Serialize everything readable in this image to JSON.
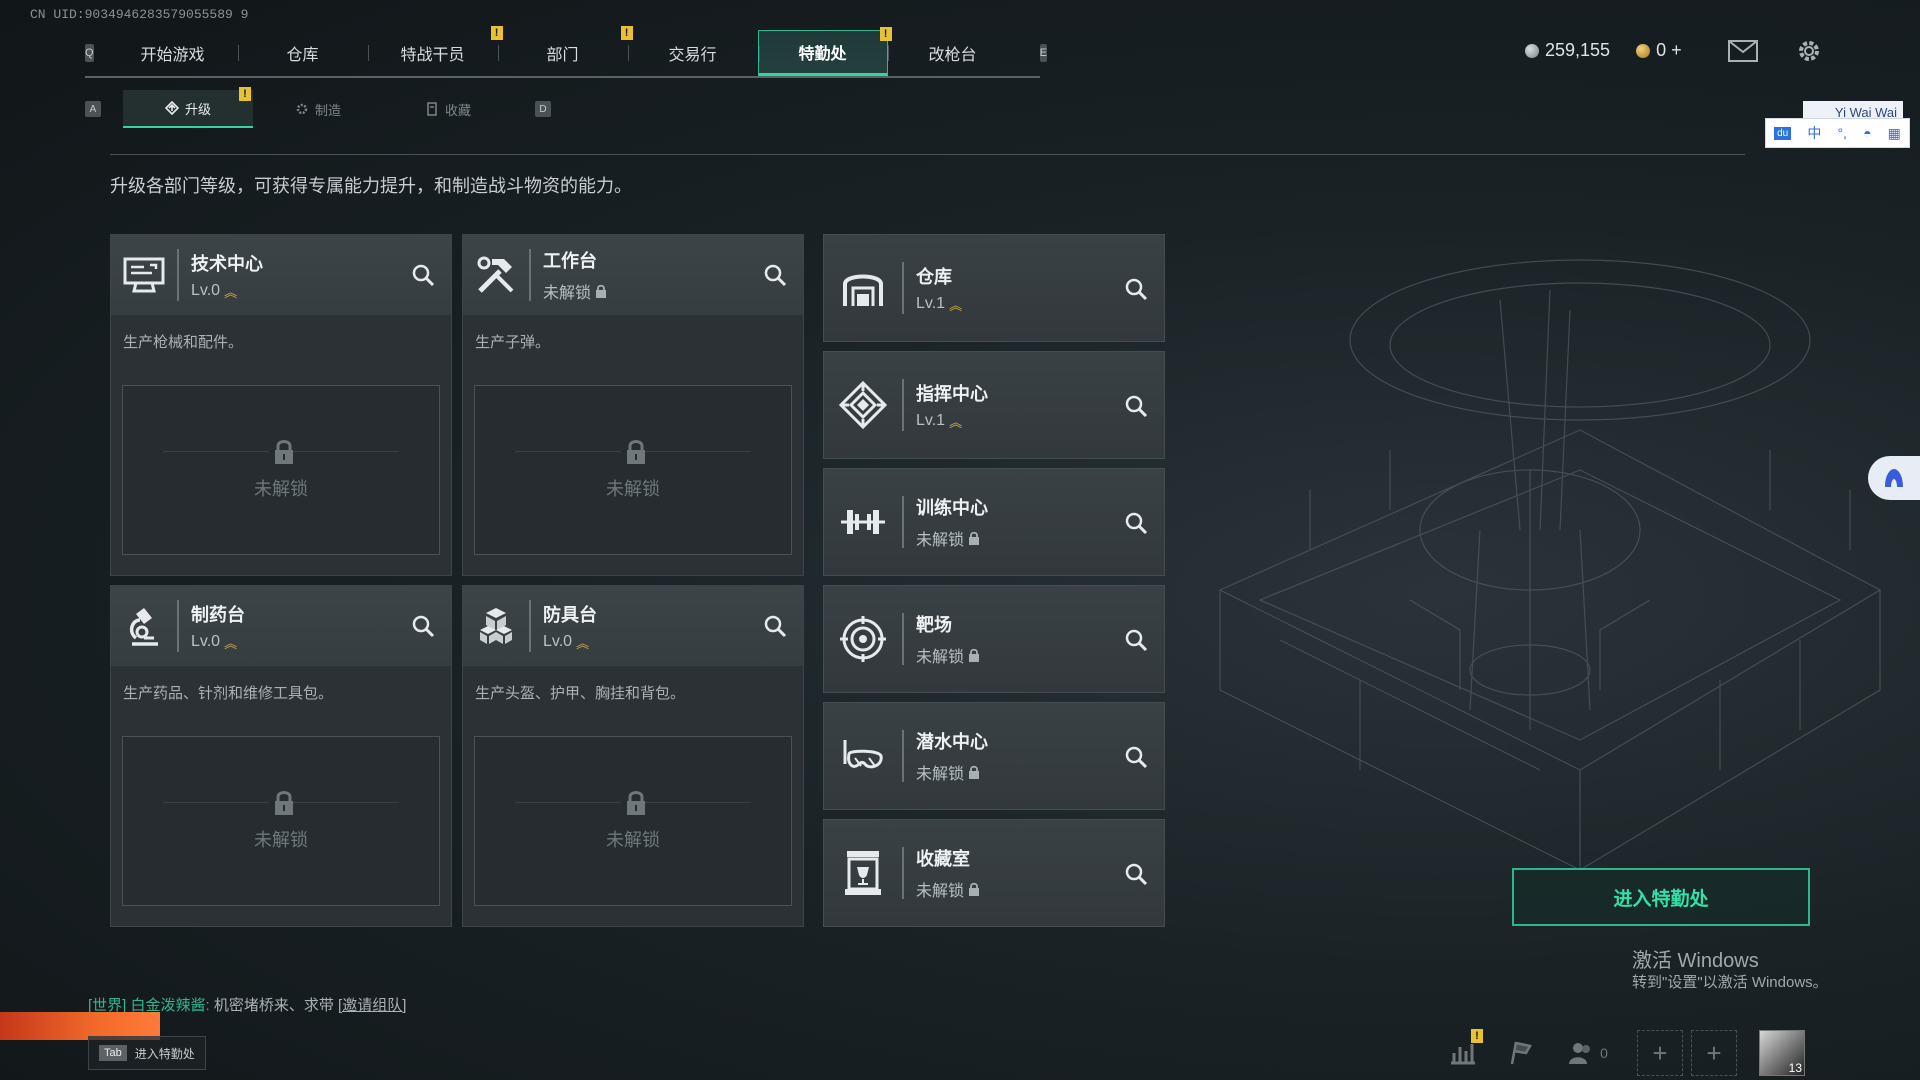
{
  "uid": "CN UID:9034946283579055589 9",
  "top_nav": {
    "left_key": "Q",
    "right_key": "E",
    "tabs": [
      {
        "label": "开始游戏",
        "badge": ""
      },
      {
        "label": "仓库",
        "badge": ""
      },
      {
        "label": "特战干员",
        "badge": "!"
      },
      {
        "label": "部门",
        "badge": "!"
      },
      {
        "label": "交易行",
        "badge": ""
      },
      {
        "label": "特勤处",
        "badge": "!",
        "active": true
      },
      {
        "label": "改枪台",
        "badge": ""
      }
    ]
  },
  "currency": {
    "silver": "259,155",
    "gold": "0 +"
  },
  "sub_nav": {
    "left_key": "A",
    "right_key": "D",
    "tabs": [
      {
        "label": "升级",
        "badge": "!"
      },
      {
        "label": "制造",
        "badge": ""
      },
      {
        "label": "收藏",
        "badge": ""
      }
    ]
  },
  "description": "升级各部门等级，可获得专属能力提升，和制造战斗物资的能力。",
  "big_cards": [
    {
      "name": "技术中心",
      "status": "Lv.0",
      "leveled": true,
      "desc": "生产枪械和配件。",
      "locked_text": "未解锁",
      "icon": "computer-icon"
    },
    {
      "name": "工作台",
      "status": "未解锁",
      "leveled": false,
      "desc": "生产子弹。",
      "locked_text": "未解锁",
      "icon": "tools-icon"
    },
    {
      "name": "制药台",
      "status": "Lv.0",
      "leveled": true,
      "desc": "生产药品、针剂和维修工具包。",
      "locked_text": "未解锁",
      "icon": "microscope-icon"
    },
    {
      "name": "防具台",
      "status": "Lv.0",
      "leveled": true,
      "desc": "生产头盔、护甲、胸挂和背包。",
      "locked_text": "未解锁",
      "icon": "boxes-icon"
    }
  ],
  "small_cards": [
    {
      "name": "仓库",
      "status": "Lv.1",
      "leveled": true,
      "icon": "warehouse-icon"
    },
    {
      "name": "指挥中心",
      "status": "Lv.1",
      "leveled": true,
      "icon": "command-icon"
    },
    {
      "name": "训练中心",
      "status": "未解锁",
      "leveled": false,
      "icon": "dumbbell-icon"
    },
    {
      "name": "靶场",
      "status": "未解锁",
      "leveled": false,
      "icon": "target-icon"
    },
    {
      "name": "潜水中心",
      "status": "未解锁",
      "leveled": false,
      "icon": "diving-mask-icon"
    },
    {
      "name": "收藏室",
      "status": "未解锁",
      "leveled": false,
      "icon": "trophy-case-icon"
    }
  ],
  "enter_button": "进入特勤处",
  "windows_activate": {
    "title": "激活 Windows",
    "subtitle": "转到\"设置\"以激活 Windows。"
  },
  "chat": {
    "channel": "[世界]",
    "user": "白金泼辣酱:",
    "message": " 机密堵桥来、求带 ",
    "link": "[邀请组队]"
  },
  "tab_hint": {
    "key": "Tab",
    "label": "进入特勤处"
  },
  "bottom": {
    "friends_count": "0",
    "level": "13",
    "badge": "!"
  },
  "ime": {
    "label": "Yi Wai Wai",
    "mode": "中"
  },
  "colors": {
    "accent": "#2fd6a0",
    "badge": "#e8c233",
    "level_arrows": "#d6b24a"
  }
}
